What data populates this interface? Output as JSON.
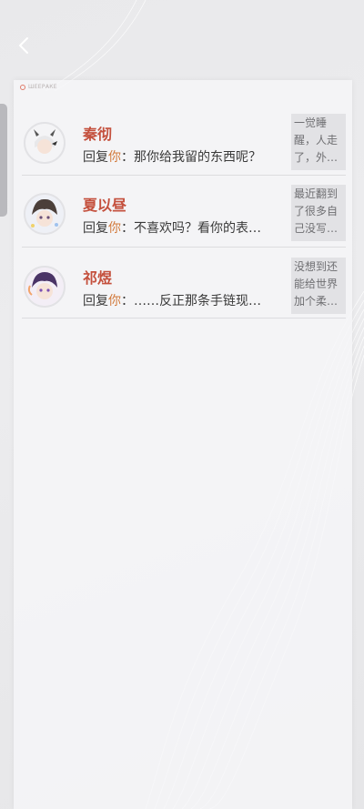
{
  "brand": {
    "logo_text": "ШЕЕРАКЕ"
  },
  "messages": [
    {
      "name": "秦彻",
      "reply_prefix": "回复",
      "reply_you": "你",
      "reply_text": "：那你给我留的东西呢？",
      "preview": "一觉睡醒，人走了，外…",
      "avatar": "avatar-qinche"
    },
    {
      "name": "夏以昼",
      "reply_prefix": "回复",
      "reply_you": "你",
      "reply_text": "：不喜欢吗？看你的表…",
      "preview": "最近翻到了很多自己没写…",
      "avatar": "avatar-xiayizhou"
    },
    {
      "name": "祁煜",
      "reply_prefix": "回复",
      "reply_you": "你",
      "reply_text": "：……反正那条手链现…",
      "preview": "没想到还能给世界加个柔…",
      "avatar": "avatar-qiyu"
    }
  ],
  "colors": {
    "name": "#c4503d",
    "you": "#d27a3c"
  }
}
